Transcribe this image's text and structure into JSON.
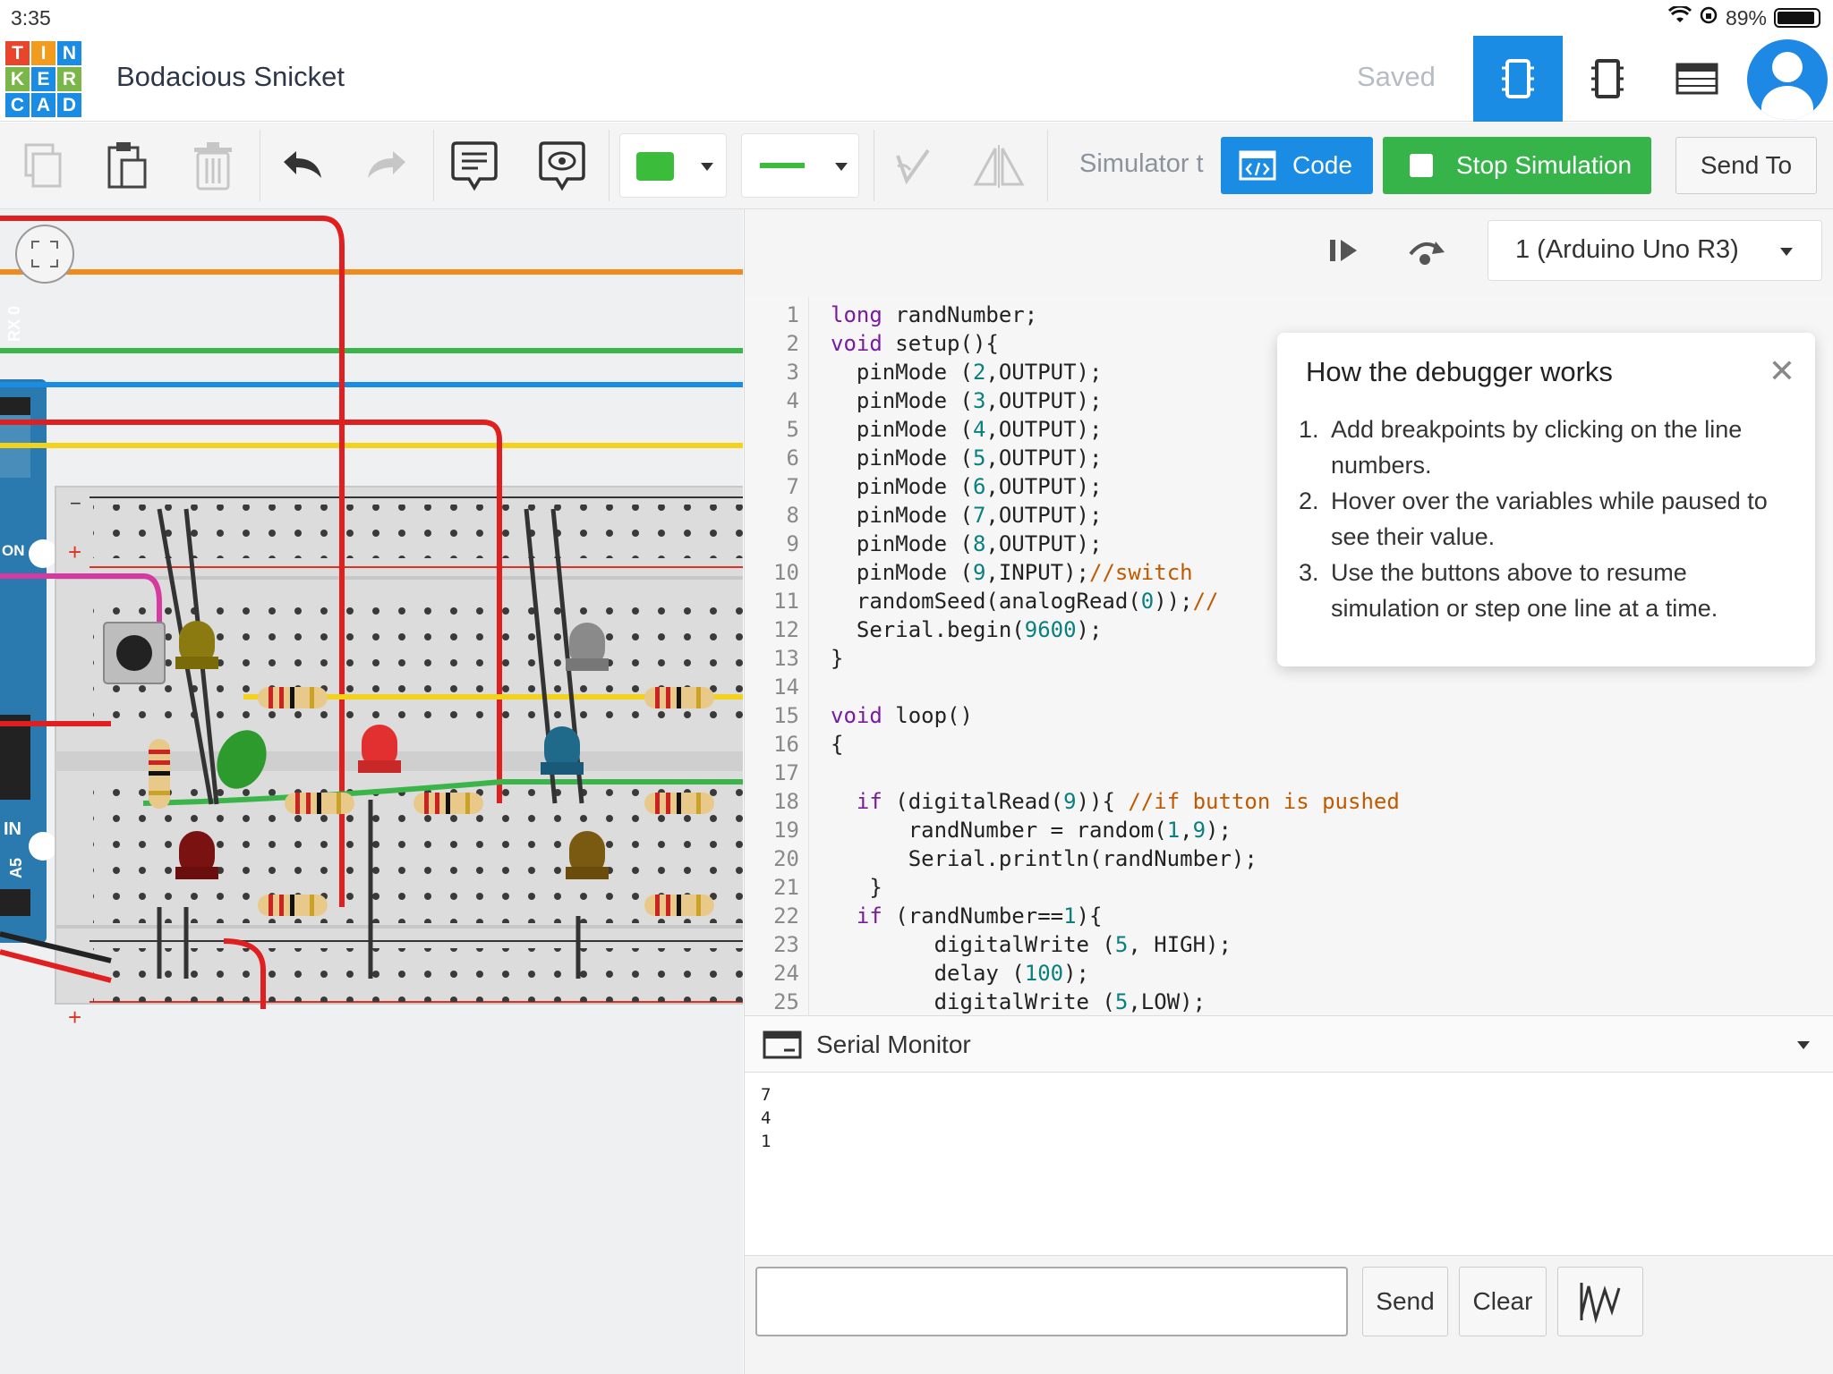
{
  "status": {
    "time": "3:35",
    "battery": "89%"
  },
  "header": {
    "logo_letters": [
      "T",
      "I",
      "N",
      "K",
      "E",
      "R",
      "C",
      "A",
      "D"
    ],
    "title": "Bodacious Snicket",
    "saved": "Saved"
  },
  "toolbar": {
    "simulator_label": "Simulator t",
    "code_label": "Code",
    "stop_label": "Stop Simulation",
    "send_to_label": "Send To",
    "wire_color": "#3bbd3b"
  },
  "debugger": {
    "device": "1 (Arduino Uno R3)"
  },
  "code": {
    "line_numbers": [
      "1",
      "2",
      "3",
      "4",
      "5",
      "6",
      "7",
      "8",
      "9",
      "10",
      "11",
      "12",
      "13",
      "14",
      "15",
      "16",
      "17",
      "18",
      "19",
      "20",
      "21",
      "22",
      "23",
      "24",
      "25"
    ]
  },
  "tooltip": {
    "title": "How the debugger works",
    "steps": [
      {
        "n": "1.",
        "text": "Add breakpoints by clicking on the line numbers."
      },
      {
        "n": "2.",
        "text": "Hover over the variables while paused to see their value."
      },
      {
        "n": "3.",
        "text": "Use the buttons above to resume simulation or step one line at a time."
      }
    ]
  },
  "serial": {
    "title": "Serial Monitor",
    "output": [
      "7",
      "4",
      "1"
    ],
    "send_label": "Send",
    "clear_label": "Clear"
  },
  "board": {
    "labels": [
      "RX 0",
      "ON",
      "IN",
      "A5"
    ],
    "rail_minus": "−",
    "rail_plus": "+"
  }
}
